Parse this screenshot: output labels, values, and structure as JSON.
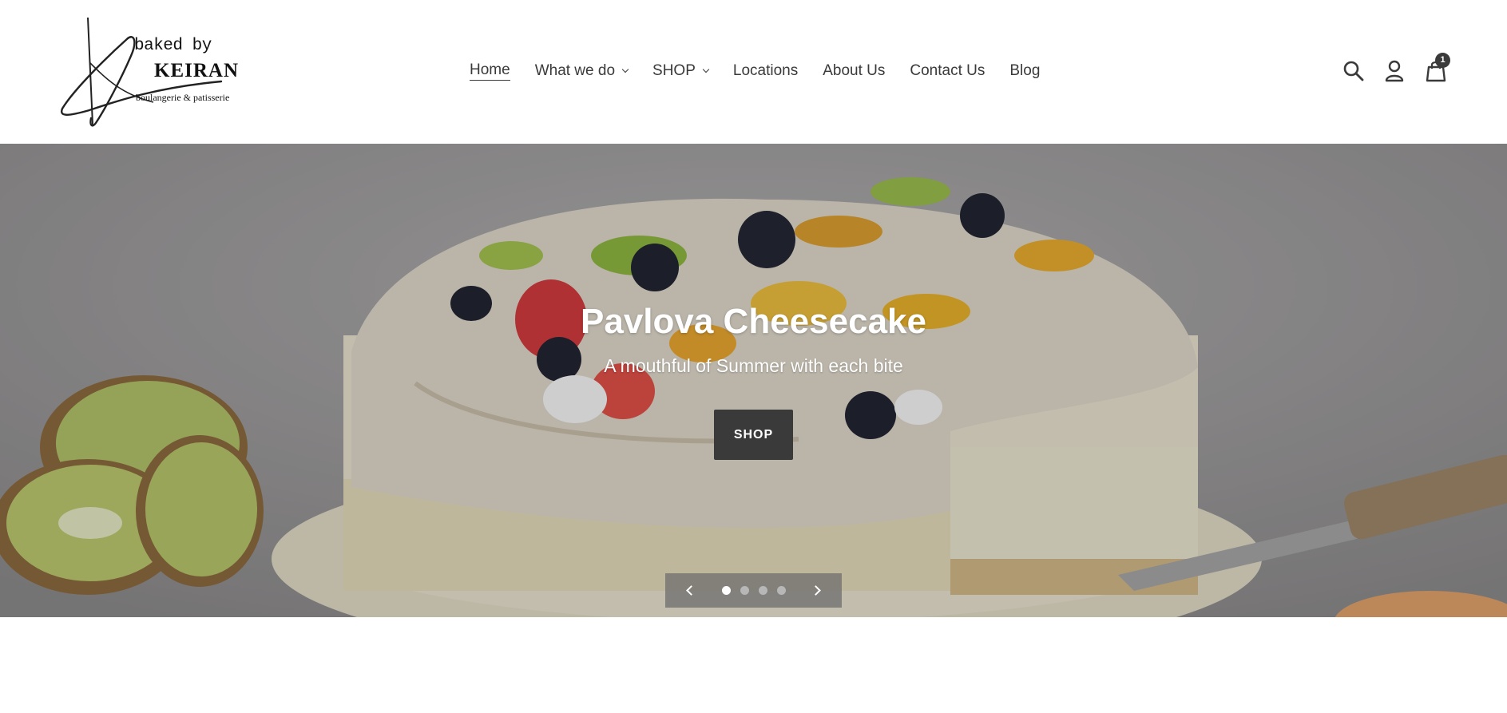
{
  "logo": {
    "line1": "baked by",
    "line2": "KEIRAN",
    "line3": "boulangerie & patisserie"
  },
  "nav": {
    "items": [
      {
        "label": "Home",
        "active": true,
        "dropdown": false
      },
      {
        "label": "What we do",
        "active": false,
        "dropdown": true
      },
      {
        "label": "SHOP",
        "active": false,
        "dropdown": true
      },
      {
        "label": "Locations",
        "active": false,
        "dropdown": false
      },
      {
        "label": "About Us",
        "active": false,
        "dropdown": false
      },
      {
        "label": "Contact Us",
        "active": false,
        "dropdown": false
      },
      {
        "label": "Blog",
        "active": false,
        "dropdown": false
      }
    ]
  },
  "header_icons": {
    "search": "search-icon",
    "account": "account-icon",
    "cart": "cart-icon",
    "cart_count": "1"
  },
  "hero": {
    "title": "Pavlova Cheesecake",
    "subtitle": "A mouthful of Summer with each bite",
    "button_label": "SHOP",
    "slides_total": 4,
    "current_slide": 1
  },
  "colors": {
    "text": "#3a3a3a",
    "button_bg": "#3a3a3a",
    "hero_bg": "#9a9899"
  }
}
